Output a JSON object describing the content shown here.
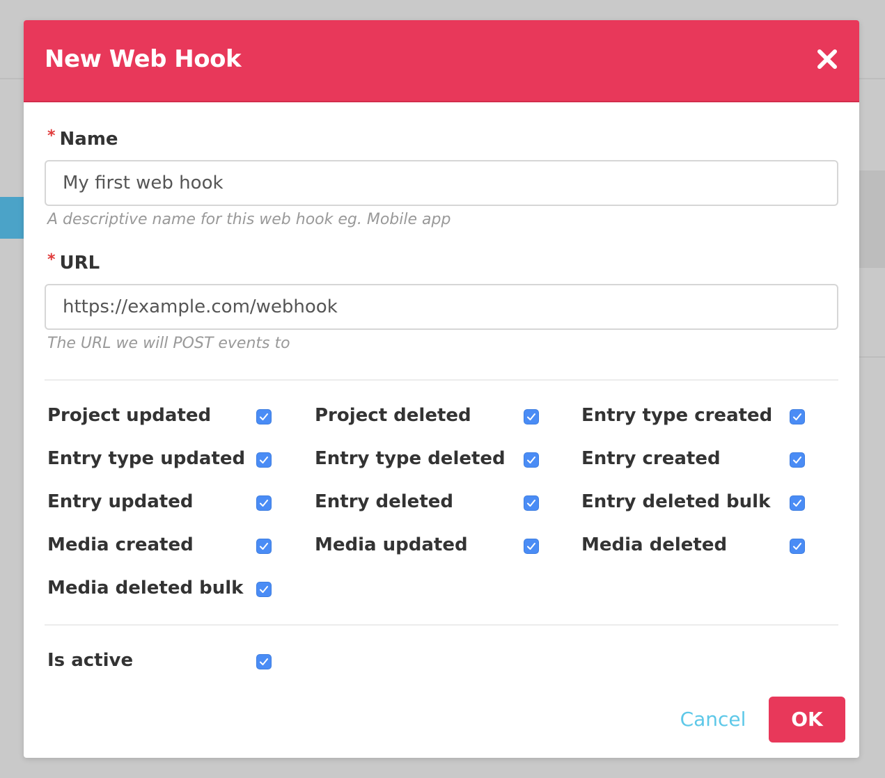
{
  "dialog": {
    "title": "New Web Hook",
    "close_icon": "close-icon"
  },
  "colors": {
    "header": "#e8385a",
    "checkbox": "#4a8cf5",
    "cancel": "#5ec8e8",
    "ok": "#e8385a"
  },
  "name_field": {
    "required_mark": "*",
    "label": "Name",
    "value": "My first web hook",
    "help": "A descriptive name for this web hook eg. Mobile app"
  },
  "url_field": {
    "required_mark": "*",
    "label": "URL",
    "value": "https://example.com/webhook",
    "help": "The URL we will POST events to"
  },
  "events": [
    {
      "label": "Project updated",
      "checked": true
    },
    {
      "label": "Project deleted",
      "checked": true
    },
    {
      "label": "Entry type created",
      "checked": true
    },
    {
      "label": "Entry type updated",
      "checked": true
    },
    {
      "label": "Entry type deleted",
      "checked": true
    },
    {
      "label": "Entry created",
      "checked": true
    },
    {
      "label": "Entry updated",
      "checked": true
    },
    {
      "label": "Entry deleted",
      "checked": true
    },
    {
      "label": "Entry deleted bulk",
      "checked": true
    },
    {
      "label": "Media created",
      "checked": true
    },
    {
      "label": "Media updated",
      "checked": true
    },
    {
      "label": "Media deleted",
      "checked": true
    },
    {
      "label": "Media deleted bulk",
      "checked": true
    }
  ],
  "is_active": {
    "label": "Is active",
    "checked": true
  },
  "buttons": {
    "cancel": "Cancel",
    "ok": "OK"
  }
}
